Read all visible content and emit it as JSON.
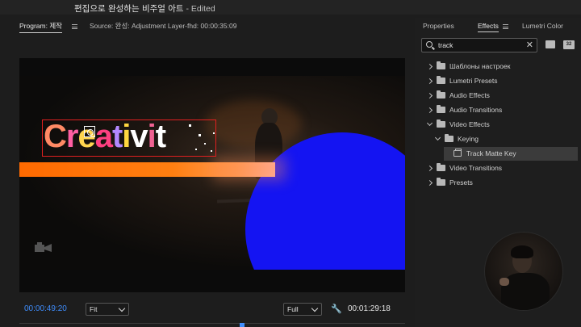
{
  "window": {
    "title": "편집으로 완성하는 비주얼 아트",
    "status": " - Edited"
  },
  "program_panel": {
    "tab_program": "Program: 제작",
    "tab_source": "Source: 완성: Adjustment Layer-fhd: 00:00:35:09",
    "video_text": [
      "C",
      "r",
      "e",
      "a",
      "t",
      "i",
      "v",
      "i",
      "t"
    ],
    "current_timecode": "00:00:49:20",
    "zoom_select": "Fit",
    "resolution_select": "Full",
    "duration_timecode": "00:01:29:18"
  },
  "effects_panel": {
    "tabs": [
      "Properties",
      "Effects",
      "Lumetri Color"
    ],
    "search_value": "track",
    "search_clear": "✕",
    "btn_32_label": "32",
    "tree": [
      {
        "label": "Шаблоны настроек",
        "expanded": false,
        "icon": "preset-folder-icon"
      },
      {
        "label": "Lumetri Presets",
        "expanded": false,
        "icon": "preset-folder-icon"
      },
      {
        "label": "Audio Effects",
        "expanded": false,
        "icon": "folder-icon"
      },
      {
        "label": "Audio Transitions",
        "expanded": false,
        "icon": "folder-icon"
      },
      {
        "label": "Video Effects",
        "expanded": true,
        "icon": "folder-icon"
      },
      {
        "label": "Keying",
        "expanded": true,
        "icon": "folder-icon"
      },
      {
        "label": "Track Matte Key",
        "expanded": false,
        "icon": "effect-icon",
        "selected": true
      },
      {
        "label": "Video Transitions",
        "expanded": false,
        "icon": "folder-icon"
      },
      {
        "label": "Presets",
        "expanded": false,
        "icon": "preset-folder-icon"
      }
    ]
  },
  "colors": {
    "accent_blue": "#3f8dfd",
    "selection_red": "#e02020",
    "matte_blue": "#1414f2",
    "bar_orange": "#ff6a00"
  }
}
